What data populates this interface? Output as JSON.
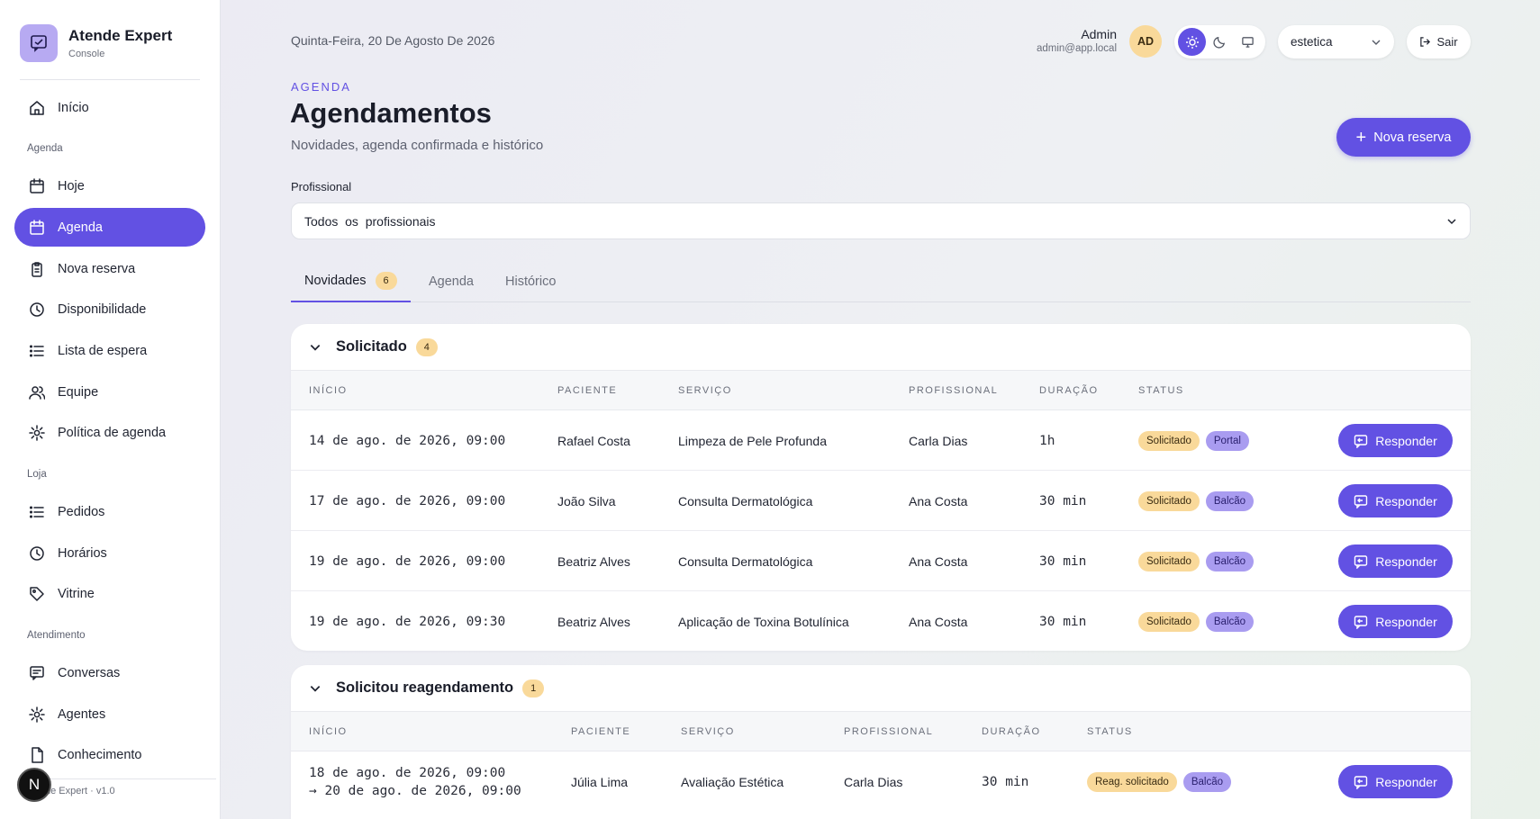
{
  "brand": {
    "name": "Atende Expert",
    "subtitle": "Console",
    "footer": "de Expert · v1.0",
    "n_badge": "N"
  },
  "nav": [
    {
      "type": "item",
      "label": "Início",
      "icon": "home-icon"
    },
    {
      "type": "section",
      "label": "Agenda"
    },
    {
      "type": "item",
      "label": "Hoje",
      "icon": "calendar-icon"
    },
    {
      "type": "item",
      "label": "Agenda",
      "icon": "calendar-icon",
      "active": true
    },
    {
      "type": "item",
      "label": "Nova reserva",
      "icon": "clipboard-icon"
    },
    {
      "type": "item",
      "label": "Disponibilidade",
      "icon": "clock-icon"
    },
    {
      "type": "item",
      "label": "Lista de espera",
      "icon": "list-icon"
    },
    {
      "type": "item",
      "label": "Equipe",
      "icon": "users-icon"
    },
    {
      "type": "item",
      "label": "Política de agenda",
      "icon": "gear-icon"
    },
    {
      "type": "section",
      "label": "Loja"
    },
    {
      "type": "item",
      "label": "Pedidos",
      "icon": "list-icon"
    },
    {
      "type": "item",
      "label": "Horários",
      "icon": "clock-icon"
    },
    {
      "type": "item",
      "label": "Vitrine",
      "icon": "tag-icon"
    },
    {
      "type": "section",
      "label": "Atendimento"
    },
    {
      "type": "item",
      "label": "Conversas",
      "icon": "chat-icon"
    },
    {
      "type": "item",
      "label": "Agentes",
      "icon": "gear-icon"
    },
    {
      "type": "item",
      "label": "Conhecimento",
      "icon": "document-icon"
    }
  ],
  "header": {
    "date": "Quinta-Feira, 20 De Agosto De 2026",
    "user_name": "Admin",
    "user_email": "admin@app.local",
    "avatar_initials": "AD",
    "tenant": "estetica",
    "logout_label": "Sair"
  },
  "page": {
    "eyebrow": "AGENDA",
    "title": "Agendamentos",
    "subtitle": "Novidades, agenda confirmada e histórico",
    "new_button": "Nova reserva",
    "filter_label": "Profissional",
    "filter_value": "Todos  os  profissionais"
  },
  "tabs": [
    {
      "label": "Novidades",
      "count": "6",
      "active": true
    },
    {
      "label": "Agenda"
    },
    {
      "label": "Histórico"
    }
  ],
  "columns": [
    "INÍCIO",
    "PACIENTE",
    "SERVIÇO",
    "PROFISSIONAL",
    "DURAÇÃO",
    "STATUS"
  ],
  "respond_label": "Responder",
  "groups": [
    {
      "title": "Solicitado",
      "count": "4",
      "rows": [
        {
          "start": "14 de ago. de 2026, 09:00",
          "patient": "Rafael Costa",
          "service": "Limpeza de Pele Profunda",
          "professional": "Carla Dias",
          "duration": "1h",
          "status": "Solicitado",
          "channel": "Portal"
        },
        {
          "start": "17 de ago. de 2026, 09:00",
          "patient": "João Silva",
          "service": "Consulta Dermatológica",
          "professional": "Ana Costa",
          "duration": "30 min",
          "status": "Solicitado",
          "channel": "Balcão"
        },
        {
          "start": "19 de ago. de 2026, 09:00",
          "patient": "Beatriz Alves",
          "service": "Consulta Dermatológica",
          "professional": "Ana Costa",
          "duration": "30 min",
          "status": "Solicitado",
          "channel": "Balcão"
        },
        {
          "start": "19 de ago. de 2026, 09:30",
          "patient": "Beatriz Alves",
          "service": "Aplicação de Toxina Botulínica",
          "professional": "Ana Costa",
          "duration": "30 min",
          "status": "Solicitado",
          "channel": "Balcão"
        }
      ]
    },
    {
      "title": "Solicitou reagendamento",
      "count": "1",
      "rows": [
        {
          "start": "18 de ago. de 2026, 09:00",
          "resched_to": "→ 20 de ago. de 2026, 09:00",
          "patient": "Júlia Lima",
          "service": "Avaliação Estética",
          "professional": "Carla Dias",
          "duration": "30 min",
          "status": "Reag. solicitado",
          "channel": "Balcão"
        }
      ]
    }
  ],
  "colors": {
    "accent": "#6251e3",
    "badge_yellow": "#f9d99a",
    "badge_purple": "#a99cf0",
    "resched": "#e8772e"
  }
}
